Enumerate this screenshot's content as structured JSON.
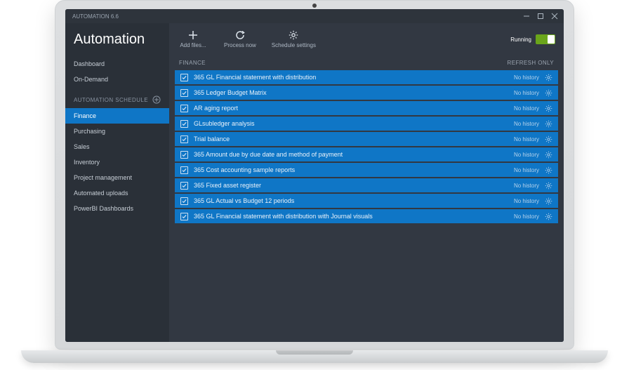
{
  "titlebar": {
    "title": "AUTOMATION 6.6"
  },
  "app": {
    "name": "Automation"
  },
  "nav": {
    "primary": [
      {
        "label": "Dashboard"
      },
      {
        "label": "On-Demand"
      }
    ],
    "section_label": "AUTOMATION SCHEDULE",
    "schedule": [
      {
        "label": "Finance",
        "active": true
      },
      {
        "label": "Purchasing"
      },
      {
        "label": "Sales"
      },
      {
        "label": "Inventory"
      },
      {
        "label": "Project management"
      },
      {
        "label": "Automated uploads"
      },
      {
        "label": "PowerBI Dashboards"
      }
    ]
  },
  "toolbar": {
    "add_label": "Add files...",
    "process_label": "Process now",
    "settings_label": "Schedule settings",
    "running_label": "Running"
  },
  "list": {
    "header_left": "FINANCE",
    "header_right": "REFRESH ONLY",
    "rows": [
      {
        "name": "365 GL Financial statement with distribution",
        "status": "No history"
      },
      {
        "name": "365 Ledger Budget Matrix",
        "status": "No history"
      },
      {
        "name": "AR aging report",
        "status": "No history"
      },
      {
        "name": "GLsubledger analysis",
        "status": "No history"
      },
      {
        "name": "Trial balance",
        "status": "No history"
      },
      {
        "name": "365 Amount due by due date and method of payment",
        "status": "No history"
      },
      {
        "name": "365 Cost accounting sample reports",
        "status": "No history"
      },
      {
        "name": "365 Fixed asset register",
        "status": "No history"
      },
      {
        "name": "365 GL Actual vs Budget 12 periods",
        "status": "No history"
      },
      {
        "name": "365 GL Financial statement with distribution with Journal visuals",
        "status": "No history"
      }
    ]
  }
}
